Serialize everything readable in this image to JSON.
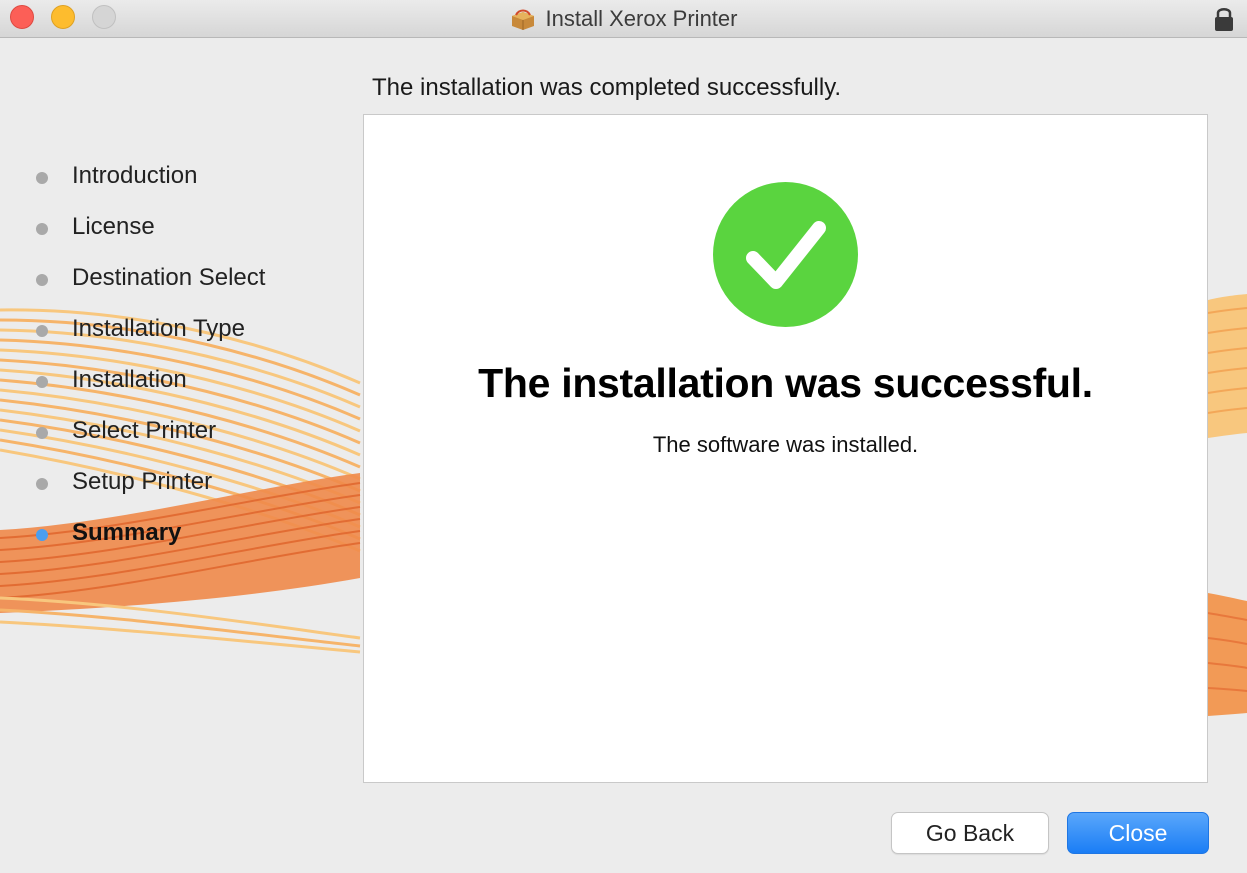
{
  "window": {
    "title": "Install Xerox Printer"
  },
  "icons": {
    "title": "installer-package-icon",
    "lock": "lock-icon",
    "success": "checkmark-circle-icon"
  },
  "colors": {
    "accent": "#1a7df5",
    "active_step": "#4a9ef0",
    "success_green": "#5ad43f",
    "wave_orange": "#f49a4a"
  },
  "sidebar": {
    "steps": [
      {
        "label": "Introduction",
        "active": false
      },
      {
        "label": "License",
        "active": false
      },
      {
        "label": "Destination Select",
        "active": false
      },
      {
        "label": "Installation Type",
        "active": false
      },
      {
        "label": "Installation",
        "active": false
      },
      {
        "label": "Select Printer",
        "active": false
      },
      {
        "label": "Setup Printer",
        "active": false
      },
      {
        "label": "Summary",
        "active": true
      }
    ]
  },
  "main": {
    "header": "The installation was completed successfully.",
    "success_title": "The installation was successful.",
    "success_subtitle": "The software was installed."
  },
  "buttons": {
    "go_back": "Go Back",
    "close": "Close"
  }
}
